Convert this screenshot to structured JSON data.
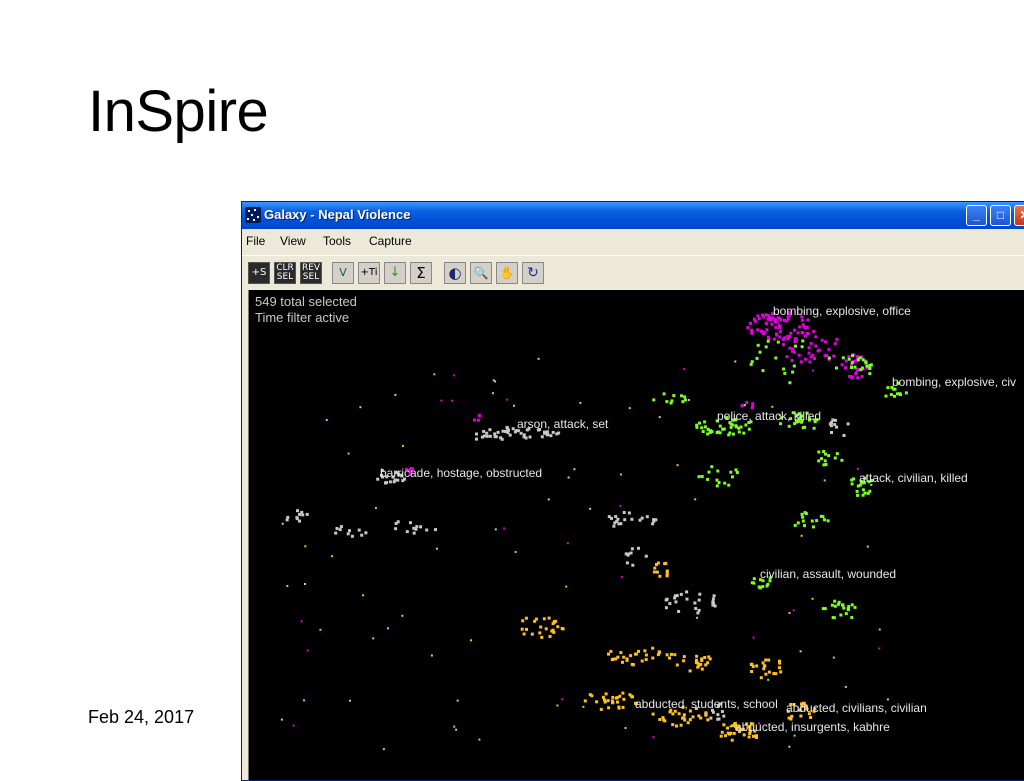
{
  "slide": {
    "title": "InSpire",
    "date": "Feb 24, 2017"
  },
  "window": {
    "title": "Galaxy - Nepal Violence",
    "controls": {
      "minimize": "_",
      "maximize": "□",
      "close": "✕"
    },
    "menu": [
      "File",
      "View",
      "Tools",
      "Capture"
    ]
  },
  "toolbar": {
    "buttons": [
      {
        "icon": "add-selection-icon",
        "label": "+S"
      },
      {
        "icon": "clear-selection-icon",
        "label": "CLR SEL"
      },
      {
        "icon": "reverse-selection-icon",
        "label": "REV SEL"
      },
      {
        "icon": "add-view-icon",
        "label": "V"
      },
      {
        "icon": "add-time-icon",
        "label": "+Ti"
      },
      {
        "icon": "arrow-down-icon",
        "label": "↓"
      },
      {
        "icon": "sum-icon",
        "label": "Σ"
      },
      {
        "icon": "contrast-icon",
        "label": "◐"
      },
      {
        "icon": "zoom-icon",
        "label": "🔍"
      },
      {
        "icon": "hand-pan-icon",
        "label": "✋"
      },
      {
        "icon": "rotate-icon",
        "label": "↻"
      }
    ]
  },
  "galaxy": {
    "status_selected": "549 total selected",
    "status_filter": "Time filter active",
    "topics": [
      "bombing, explosive, office",
      "bombing, explosive, civ",
      "arson, attack, set",
      "police, attack, killed",
      "barricade, hostage, obstructed",
      "attack, civilian, killed",
      "civilian, assault, wounded",
      "abducted, students, school",
      "abducted, civilians, civilian",
      "abducted, insurgents, kabhre"
    ],
    "colors": {
      "magenta": "#e000e0",
      "green": "#7cff20",
      "gray": "#c8c8c8",
      "yellow": "#ffc020",
      "background": "#000000"
    }
  }
}
